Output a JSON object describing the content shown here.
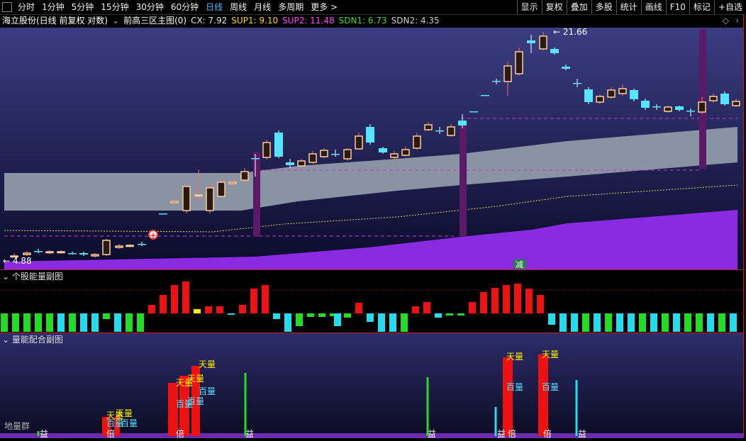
{
  "toolbar": {
    "periods": [
      "分时",
      "1分钟",
      "5分钟",
      "15分钟",
      "30分钟",
      "60分钟",
      "日线",
      "周线",
      "月线",
      "多周期",
      "更多 >"
    ],
    "active_period": "日线",
    "right_buttons": [
      "显示",
      "复权",
      "叠加",
      "多股",
      "统计",
      "画线",
      "F10",
      "标记",
      "+自选"
    ]
  },
  "title": {
    "stock": "海立股份(日线 前复权 对数)",
    "indicator": "前高三区主图(0)",
    "cx_label": "CX: 7.92",
    "sup1_label": "SUP1: 9.10",
    "sup2_label": "SUP2: 11.48",
    "sdn1_label": "SDN1: 6.73",
    "sdn2_label": "SDN2: 4.35"
  },
  "colors": {
    "cx": "#e8e8e8",
    "sup1": "#ffd700",
    "sup2": "#ff44ff",
    "sdn1": "#33dd33",
    "sdn2": "#cccccc",
    "up": "#ff3333",
    "down": "#55e5ff",
    "band": "#8a93a4",
    "purple": "#8a2be2"
  },
  "main": {
    "high_label": "21.66",
    "low_label": "4.88",
    "signal_label": "减"
  },
  "sub1": {
    "title": "个股能量副图"
  },
  "sub2": {
    "title": "量能配合副图",
    "footer_label": "地量群",
    "labels": {
      "tian": "天量",
      "bai": "百量",
      "bei": "倍",
      "yi": "益"
    }
  }
}
